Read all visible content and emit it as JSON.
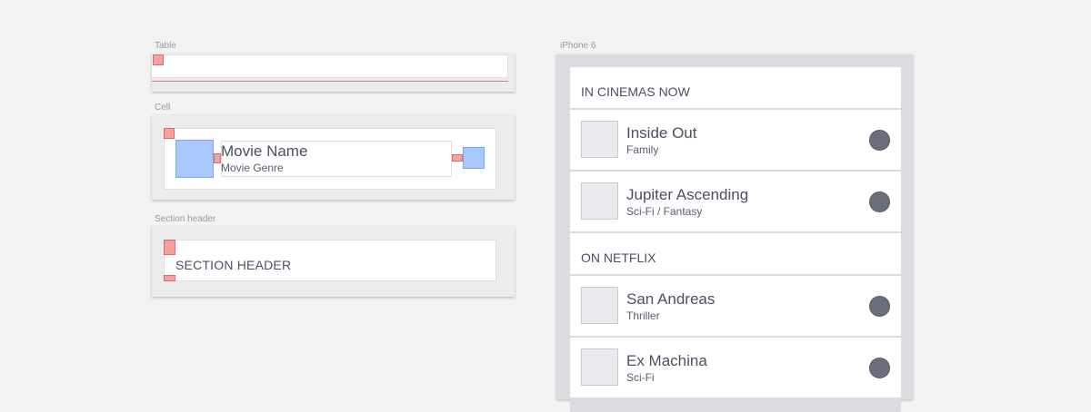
{
  "labels": {
    "table": "Table",
    "cell": "Cell",
    "section_header": "Section header",
    "iphone": "iPhone 6"
  },
  "cell_component": {
    "title": "Movie Name",
    "subtitle": "Movie Genre"
  },
  "section_component": {
    "text": "SECTION HEADER"
  },
  "phone": {
    "sections": [
      {
        "header": "IN CINEMAS NOW",
        "rows": [
          {
            "title": "Inside Out",
            "subtitle": "Family"
          },
          {
            "title": "Jupiter Ascending",
            "subtitle": "Sci-Fi / Fantasy"
          }
        ]
      },
      {
        "header": "ON NETFLIX",
        "rows": [
          {
            "title": "San Andreas",
            "subtitle": "Thriller"
          },
          {
            "title": "Ex Machina",
            "subtitle": "Sci-Fi"
          }
        ]
      }
    ]
  },
  "colors": {
    "constraint_red": "#f2a0a0",
    "placeholder_blue": "#a9c8ff",
    "indicator_dot": "#6a6e7c"
  }
}
